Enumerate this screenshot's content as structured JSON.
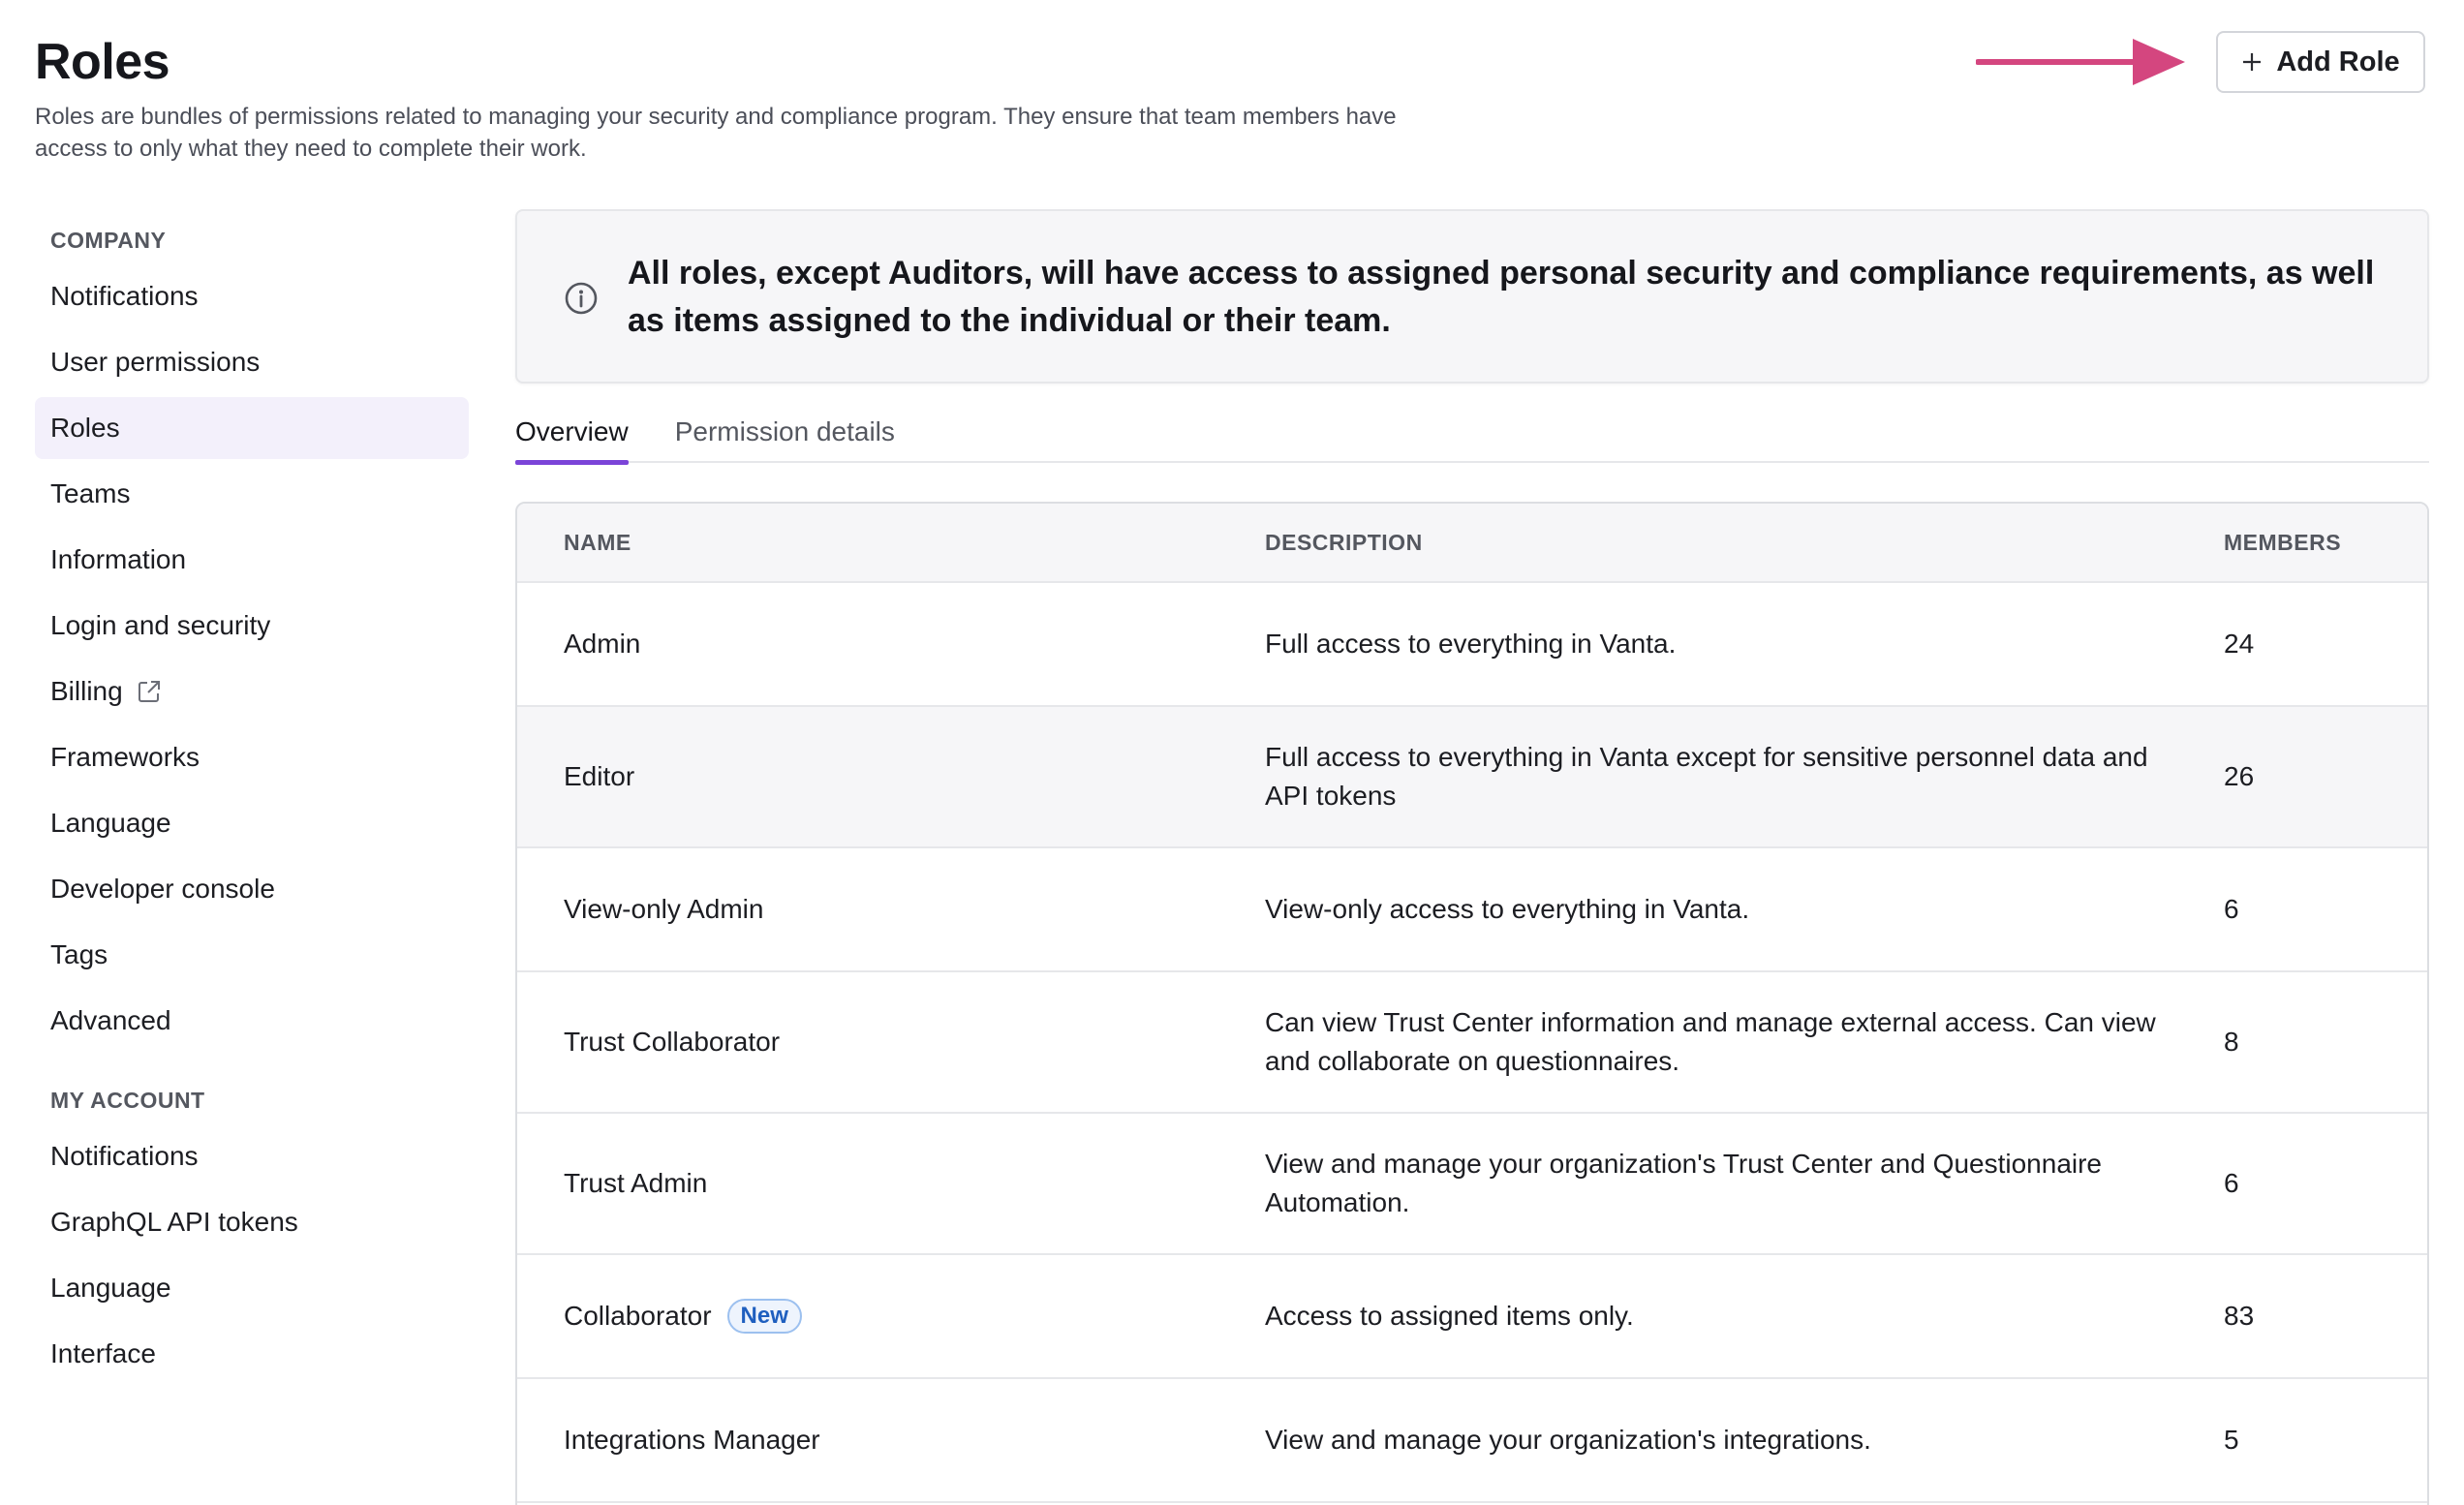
{
  "header": {
    "title": "Roles",
    "subtitle": "Roles are bundles of permissions related to managing your security and compliance program. They ensure that team members have access to only what they need to complete their work.",
    "add_role_label": "Add Role"
  },
  "colors": {
    "accent": "#7b44d8",
    "annotation_arrow": "#d4467f",
    "active_sidebar_bg": "#f3f0fb",
    "badge_blue": "#1f5fbf"
  },
  "sidebar": {
    "company_title": "COMPANY",
    "company_items": [
      {
        "label": "Notifications"
      },
      {
        "label": "User permissions"
      },
      {
        "label": "Roles",
        "active": true
      },
      {
        "label": "Teams"
      },
      {
        "label": "Information"
      },
      {
        "label": "Login and security"
      },
      {
        "label": "Billing",
        "icon": "external-link-icon"
      },
      {
        "label": "Frameworks"
      },
      {
        "label": "Language"
      },
      {
        "label": "Developer console"
      },
      {
        "label": "Tags"
      },
      {
        "label": "Advanced"
      }
    ],
    "account_title": "MY ACCOUNT",
    "account_items": [
      {
        "label": "Notifications"
      },
      {
        "label": "GraphQL API tokens"
      },
      {
        "label": "Language"
      },
      {
        "label": "Interface"
      }
    ]
  },
  "banner": {
    "icon": "info-icon",
    "text": "All roles, except Auditors, will have access to assigned personal security and compliance requirements, as well as items assigned to the individual or their team."
  },
  "tabs": [
    {
      "label": "Overview",
      "active": true
    },
    {
      "label": "Permission details"
    }
  ],
  "table": {
    "columns": {
      "name": "NAME",
      "description": "DESCRIPTION",
      "members": "MEMBERS"
    },
    "rows": [
      {
        "name": "Admin",
        "description": "Full access to everything in Vanta.",
        "members": "24"
      },
      {
        "name": "Editor",
        "description": "Full access to everything in Vanta except for sensitive personnel data and API tokens",
        "members": "26"
      },
      {
        "name": "View-only Admin",
        "description": "View-only access to everything in Vanta.",
        "members": "6"
      },
      {
        "name": "Trust Collaborator",
        "description": "Can view Trust Center information and manage external access. Can view and collaborate on questionnaires.",
        "members": "8"
      },
      {
        "name": "Trust Admin",
        "description": "View and manage your organization's Trust Center and Questionnaire Automation.",
        "members": "6"
      },
      {
        "name": "Collaborator",
        "badge": "New",
        "description": "Access to assigned items only.",
        "members": "83"
      },
      {
        "name": "Integrations Manager",
        "description": "View and manage your organization's integrations.",
        "members": "5"
      }
    ]
  }
}
